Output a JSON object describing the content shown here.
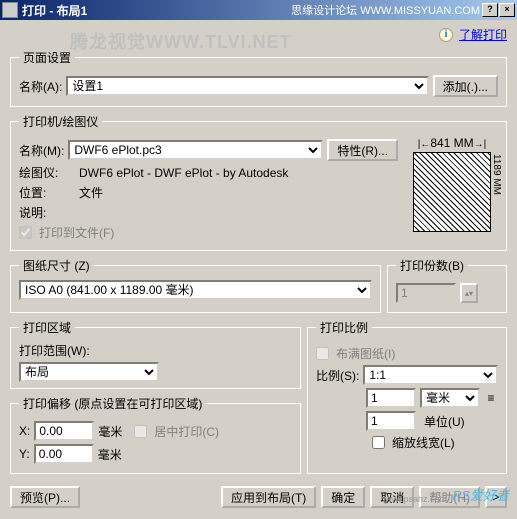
{
  "titlebar": {
    "title": "打印 - 布局1",
    "subtitle": "思缘设计论坛 WWW.MISSYUAN.COM",
    "help": "?",
    "close": "×"
  },
  "info": {
    "learn_print": "了解打印"
  },
  "page_setup": {
    "legend": "页面设置",
    "name_label": "名称(A):",
    "name_value": "设置1",
    "add_btn": "添加(.)..."
  },
  "printer": {
    "legend": "打印机/绘图仪",
    "name_label": "名称(M):",
    "name_value": "DWF6 ePlot.pc3",
    "props_btn": "特性(R)...",
    "plotter_label": "绘图仪:",
    "plotter_value": "DWF6 ePlot - DWF ePlot - by Autodesk",
    "location_label": "位置:",
    "location_value": "文件",
    "desc_label": "说明:",
    "to_file_label": "打印到文件(F)",
    "dim_w": "841 MM",
    "dim_h": "1189 MM"
  },
  "paper": {
    "legend": "图纸尺寸 (Z)",
    "value": "ISO A0 (841.00 x 1189.00 毫米)"
  },
  "copies": {
    "legend": "打印份数(B)",
    "value": "1"
  },
  "area": {
    "legend": "打印区域",
    "range_label": "打印范围(W):",
    "range_value": "布局"
  },
  "scale": {
    "legend": "打印比例",
    "fit_label": "布满图纸(I)",
    "scale_label": "比例(S):",
    "scale_value": "1:1",
    "mm_value": "1",
    "mm_unit": "毫米",
    "unit_value": "1",
    "unit_label": "单位(U)",
    "lineweight_label": "缩放线宽(L)"
  },
  "offset": {
    "legend": "打印偏移 (原点设置在可打印区域)",
    "x_label": "X:",
    "x_value": "0.00",
    "y_label": "Y:",
    "y_value": "0.00",
    "unit": "毫米",
    "center_label": "居中打印(C)"
  },
  "buttons": {
    "preview": "预览(P)...",
    "apply": "应用到布局(T)",
    "ok": "确定",
    "cancel": "取消",
    "help": "帮助(H)",
    "expand": ">"
  },
  "watermark": "腾龙视觉WWW.TLVI.NET",
  "wm2": "PS爱好者",
  "wm3": "www.psahz.com"
}
